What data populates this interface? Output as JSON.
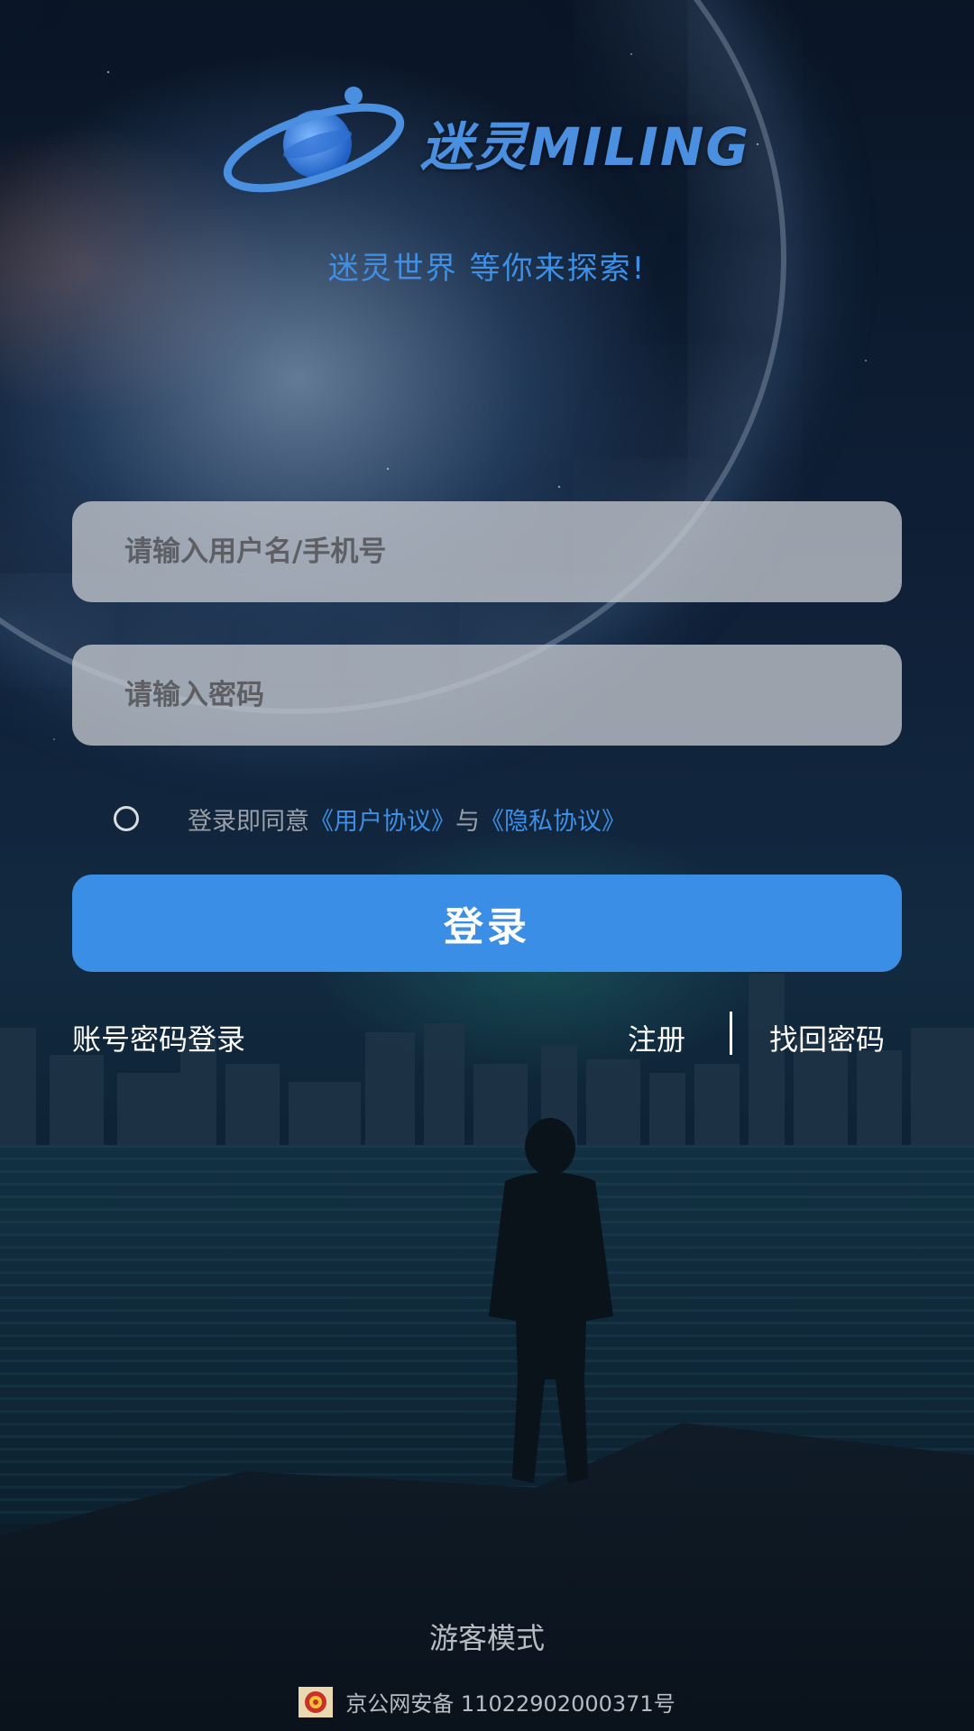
{
  "logo": {
    "text": "迷灵MILING"
  },
  "slogan": "迷灵世界 等你来探索!",
  "form": {
    "username_placeholder": "请输入用户名/手机号",
    "password_placeholder": "请输入密码"
  },
  "agreement": {
    "prefix": "登录即同意",
    "user_agreement": "《用户协议》",
    "conjunction": "与",
    "privacy_agreement": "《隐私协议》",
    "checked": false
  },
  "login_button": "登录",
  "links": {
    "account_login": "账号密码登录",
    "register": "注册",
    "forgot_password": "找回密码"
  },
  "guest_mode": "游客模式",
  "icp": {
    "icon": "police-badge-icon",
    "text": "京公网安备 11022902000371号"
  },
  "colors": {
    "accent": "#3a8ee6",
    "link": "#3e8fe6"
  }
}
